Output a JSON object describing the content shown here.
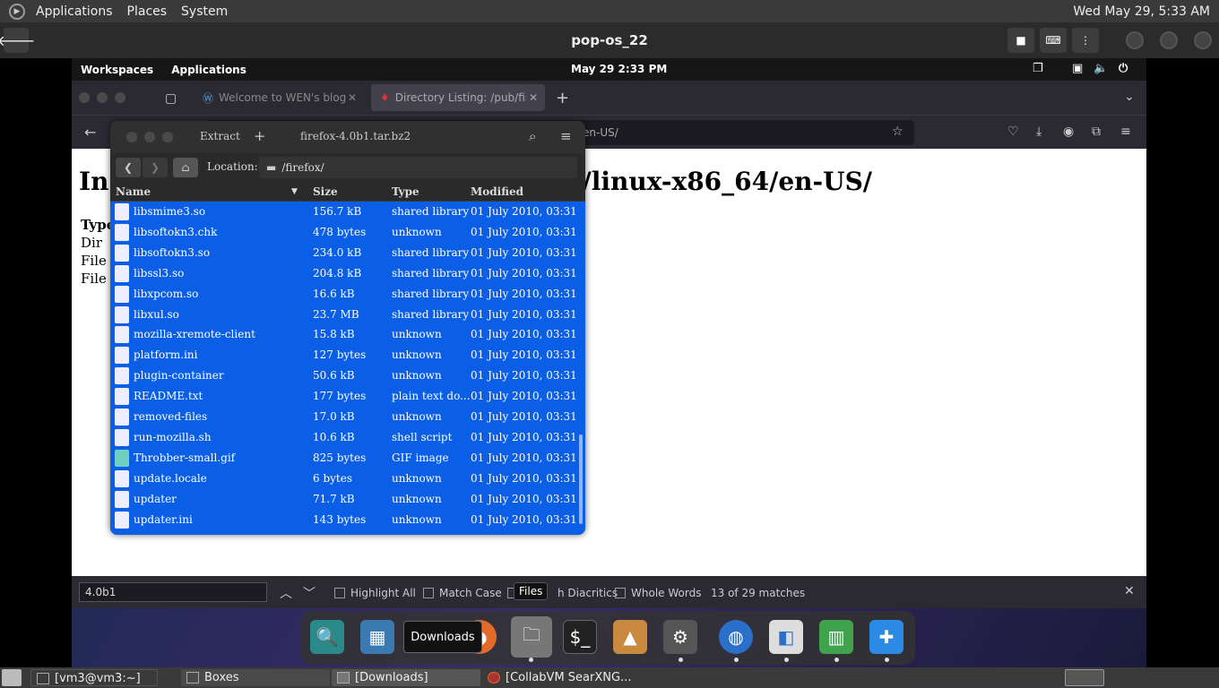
{
  "host_top": {
    "menu": [
      "Applications",
      "Places",
      "System"
    ],
    "clock": "Wed May 29,  5:33 AM"
  },
  "boxes": {
    "title": "pop-os_22"
  },
  "guest_top": {
    "menu": [
      "Workspaces",
      "Applications"
    ],
    "clock": "May 29   2:33 PM"
  },
  "firefox": {
    "tabs": [
      {
        "label": "Welcome to WEN's blog"
      },
      {
        "label": "Directory Listing: /pub/firef"
      }
    ],
    "url_tail": "en-US/",
    "page": {
      "heading_start": "In",
      "heading_end": "/linux-x86_64/en-US/",
      "lines": [
        "Type",
        "Dir",
        "File",
        "File"
      ]
    },
    "findbar": {
      "query": "4.0b1",
      "highlight_all": "Highlight All",
      "match_case": "Match Case",
      "diacritics": "h Diacritics",
      "whole_words": "Whole Words",
      "matches": "13 of 29 matches"
    }
  },
  "dock": {
    "tooltip_downloads": "Downloads",
    "tooltip_files": "Files"
  },
  "file_roller": {
    "extract_label": "Extract",
    "add_label": "+",
    "title": "firefox-4.0b1.tar.bz2",
    "location_label": "Location:",
    "location_path": "/firefox/",
    "columns": {
      "name": "Name",
      "size": "Size",
      "type": "Type",
      "modified": "Modified"
    },
    "files": [
      {
        "name": "libsmime3.so",
        "size": "156.7 kB",
        "type": "shared library",
        "modified": "01 July 2010, 03:31"
      },
      {
        "name": "libsoftokn3.chk",
        "size": "478 bytes",
        "type": "unknown",
        "modified": "01 July 2010, 03:31"
      },
      {
        "name": "libsoftokn3.so",
        "size": "234.0 kB",
        "type": "shared library",
        "modified": "01 July 2010, 03:31"
      },
      {
        "name": "libssl3.so",
        "size": "204.8 kB",
        "type": "shared library",
        "modified": "01 July 2010, 03:31"
      },
      {
        "name": "libxpcom.so",
        "size": "16.6 kB",
        "type": "shared library",
        "modified": "01 July 2010, 03:31"
      },
      {
        "name": "libxul.so",
        "size": "23.7 MB",
        "type": "shared library",
        "modified": "01 July 2010, 03:31"
      },
      {
        "name": "mozilla-xremote-client",
        "size": "15.8 kB",
        "type": "unknown",
        "modified": "01 July 2010, 03:31"
      },
      {
        "name": "platform.ini",
        "size": "127 bytes",
        "type": "unknown",
        "modified": "01 July 2010, 03:31"
      },
      {
        "name": "plugin-container",
        "size": "50.6 kB",
        "type": "unknown",
        "modified": "01 July 2010, 03:31"
      },
      {
        "name": "README.txt",
        "size": "177 bytes",
        "type": "plain text do...",
        "modified": "01 July 2010, 03:31"
      },
      {
        "name": "removed-files",
        "size": "17.0 kB",
        "type": "unknown",
        "modified": "01 July 2010, 03:31"
      },
      {
        "name": "run-mozilla.sh",
        "size": "10.6 kB",
        "type": "shell script",
        "modified": "01 July 2010, 03:31"
      },
      {
        "name": "Throbber-small.gif",
        "size": "825 bytes",
        "type": "GIF image",
        "modified": "01 July 2010, 03:31"
      },
      {
        "name": "update.locale",
        "size": "6 bytes",
        "type": "unknown",
        "modified": "01 July 2010, 03:31"
      },
      {
        "name": "updater",
        "size": "71.7 kB",
        "type": "unknown",
        "modified": "01 July 2010, 03:31"
      },
      {
        "name": "updater.ini",
        "size": "143 bytes",
        "type": "unknown",
        "modified": "01 July 2010, 03:31"
      }
    ]
  },
  "host_taskbar": {
    "tasks": [
      "[vm3@vm3:~]",
      "Boxes",
      "[Downloads]",
      "[CollabVM SearXNG..."
    ]
  }
}
